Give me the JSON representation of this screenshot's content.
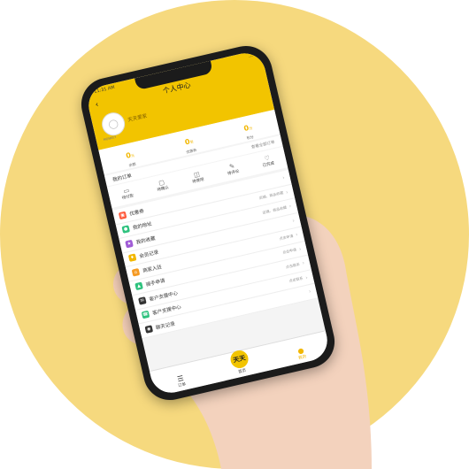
{
  "status": {
    "time": "11:31 AM",
    "signal": "..."
  },
  "header": {
    "title": "个人中心",
    "back": "‹",
    "avatar_caption": "MONKEY",
    "user_name": "天天爱家"
  },
  "stats": [
    {
      "value": "0",
      "unit": "元",
      "label": "余额"
    },
    {
      "value": "0",
      "unit": "张",
      "label": "优惠券"
    },
    {
      "value": "0",
      "unit": "分",
      "label": "积分"
    }
  ],
  "orders": {
    "title": "我的订单",
    "all": "查看全部订单",
    "tabs": [
      "待付款",
      "待确认",
      "待使用",
      "待评论",
      "已完成"
    ]
  },
  "menu": [
    {
      "icon": "coupon-icon",
      "label": "优惠券",
      "hint": "",
      "color": "#ff5a3c"
    },
    {
      "icon": "address-icon",
      "label": "我的地址",
      "hint": "店铺、商品收藏",
      "color": "#2ec27e"
    },
    {
      "icon": "favorite-icon",
      "label": "我的收藏",
      "hint": "店铺、商品收藏",
      "color": "#a05cd6"
    },
    {
      "icon": "member-icon",
      "label": "会员记录",
      "hint": "",
      "color": "#f2b700"
    },
    {
      "icon": "merchant-icon",
      "label": "商家入驻",
      "hint": "点击申请",
      "color": "#f59a23"
    },
    {
      "icon": "courier-icon",
      "label": "骑手申请",
      "hint": "点击申请",
      "color": "#2ec27e"
    },
    {
      "icon": "support-icon",
      "label": "客户支援中心",
      "hint": "点击联系",
      "color": "#333333"
    },
    {
      "icon": "support2-icon",
      "label": "客户支援中心",
      "hint": "点击联系",
      "color": "#2ec27e"
    },
    {
      "icon": "chat-icon",
      "label": "聊天记录",
      "hint": "",
      "color": "#333333"
    }
  ],
  "tabbar": {
    "order": "订单",
    "home": "首页",
    "home_badge": "天天",
    "mine": "我的"
  }
}
